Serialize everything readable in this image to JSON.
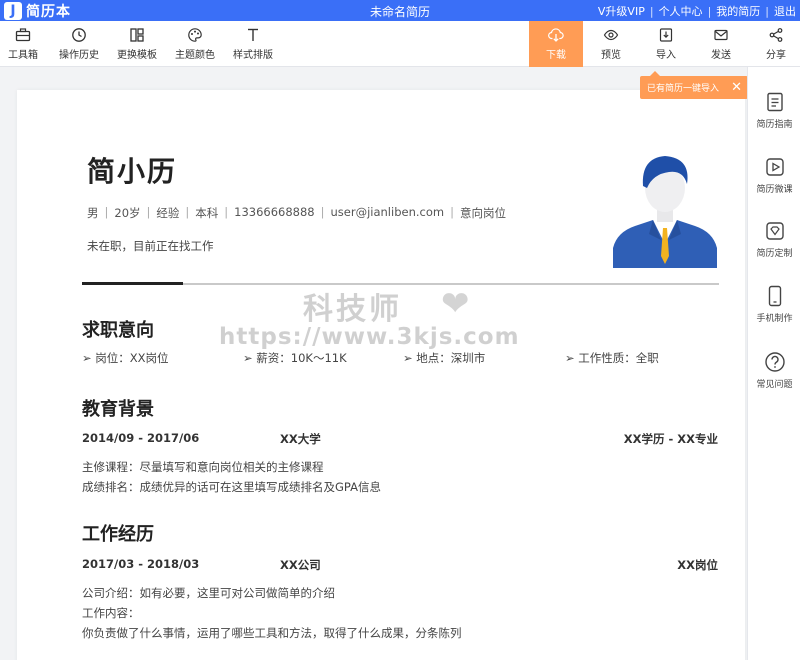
{
  "app": {
    "logo_letter": "J",
    "logo_text": "简历本",
    "doc_title": "未命名简历"
  },
  "top_links": [
    "V升级VIP",
    "个人中心",
    "我的简历",
    "退出"
  ],
  "toolbar": {
    "left": [
      {
        "label": "工具箱",
        "icon": "toolbox-icon"
      },
      {
        "label": "操作历史",
        "icon": "history-icon"
      },
      {
        "label": "更换模板",
        "icon": "template-icon"
      },
      {
        "label": "主题颜色",
        "icon": "palette-icon"
      },
      {
        "label": "样式排版",
        "icon": "text-style-icon"
      }
    ],
    "right": [
      {
        "label": "下载",
        "icon": "download-icon"
      },
      {
        "label": "预览",
        "icon": "eye-icon"
      },
      {
        "label": "导入",
        "icon": "import-icon"
      },
      {
        "label": "发送",
        "icon": "mail-icon"
      },
      {
        "label": "分享",
        "icon": "share-icon"
      }
    ]
  },
  "tooltip": {
    "text": "已有简历一键导入",
    "close": "✕"
  },
  "right_sidebar": [
    {
      "label": "简历指南",
      "icon": "guide-icon"
    },
    {
      "label": "简历微课",
      "icon": "video-icon"
    },
    {
      "label": "简历定制",
      "icon": "custom-icon"
    },
    {
      "label": "手机制作",
      "icon": "phone-icon"
    },
    {
      "label": "常见问题",
      "icon": "question-icon"
    }
  ],
  "resume": {
    "name": "简小历",
    "info": [
      "男",
      "20岁",
      "经验",
      "本科",
      "13366668888",
      "user@jianliben.com",
      "意向岗位"
    ],
    "status": "未在职，目前正在找工作",
    "sections": {
      "intent_title": "求职意向",
      "intent": [
        {
          "label": "岗位：",
          "value": "XX岗位"
        },
        {
          "label": "薪资：",
          "value": "10K～11K"
        },
        {
          "label": "地点：",
          "value": "深圳市"
        },
        {
          "label": "工作性质：",
          "value": "全职"
        }
      ],
      "edu_title": "教育背景",
      "edu": {
        "period": "2014/09 - 2017/06",
        "school": "XX大学",
        "degree": "XX学历 - XX专业",
        "lines": [
          "主修课程：尽量填写和意向岗位相关的主修课程",
          "成绩排名：成绩优异的话可在这里填写成绩排名及GPA信息"
        ]
      },
      "work_title": "工作经历",
      "work": {
        "period": "2017/03 - 2018/03",
        "company": "XX公司",
        "position": "XX岗位",
        "lines": [
          "公司介绍：如有必要，这里可对公司做简单的介绍",
          "工作内容：",
          "你负责做了什么事情，运用了哪些工具和方法，取得了什么成果，分条陈列"
        ]
      }
    }
  },
  "watermark": {
    "line1": "科技师",
    "heart": "❤",
    "line2": "https://www.3kjs.com"
  },
  "colors": {
    "brand": "#3a6ff7",
    "accent": "#ff9c55"
  }
}
